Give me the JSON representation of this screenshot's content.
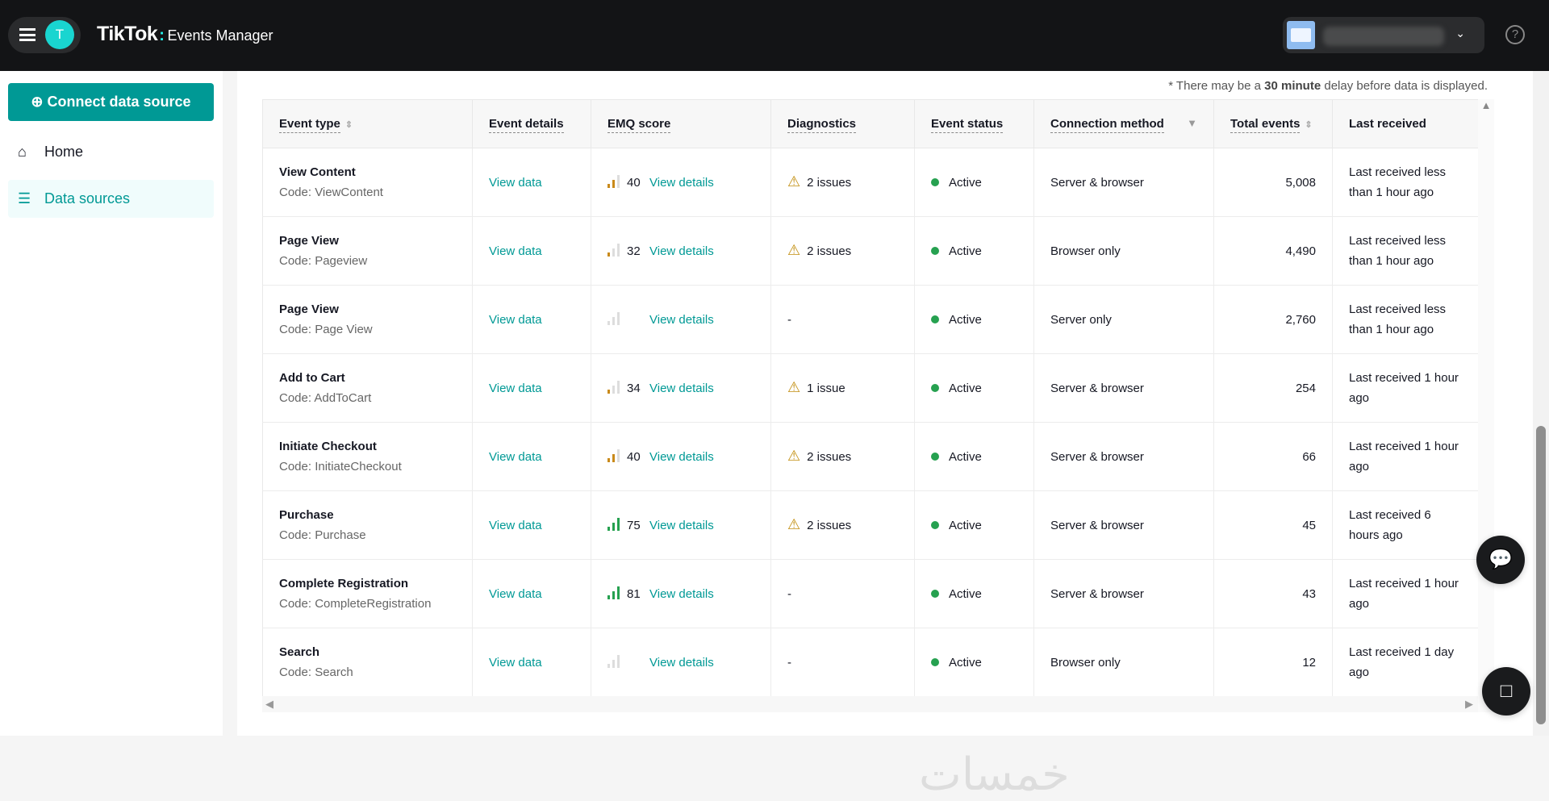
{
  "header": {
    "avatar_letter": "T",
    "logo": "TikTok",
    "app_name": "Events Manager",
    "help": "?"
  },
  "sidebar": {
    "connect_label": "Connect data source",
    "items": [
      {
        "label": "Home"
      },
      {
        "label": "Data sources"
      }
    ]
  },
  "note": {
    "prefix": "* There may be a ",
    "bold": "30 minute",
    "suffix": " delay before data is displayed."
  },
  "table": {
    "columns": [
      "Event type",
      "Event details",
      "EMQ score",
      "Diagnostics",
      "Event status",
      "Connection method",
      "Total events",
      "Last received"
    ],
    "rows": [
      {
        "name": "View Content",
        "code": "Code: ViewContent",
        "details": "View data",
        "emq": "40",
        "emq_level": 2,
        "emq_color": "#c98a1b",
        "emq_link": "View details",
        "diag": "2 issues",
        "warn": true,
        "status": "Active",
        "method": "Server & browser",
        "total": "5,008",
        "last": "Last received less than 1 hour ago"
      },
      {
        "name": "Page View",
        "code": "Code: Pageview",
        "details": "View data",
        "emq": "32",
        "emq_level": 1,
        "emq_color": "#c98a1b",
        "emq_link": "View details",
        "diag": "2 issues",
        "warn": true,
        "status": "Active",
        "method": "Browser only",
        "total": "4,490",
        "last": "Last received less than 1 hour ago"
      },
      {
        "name": "Page View",
        "code": "Code: Page View",
        "details": "View data",
        "emq": "",
        "emq_level": 0,
        "emq_color": "#dddddd",
        "emq_link": "View details",
        "diag": "-",
        "warn": false,
        "status": "Active",
        "method": "Server only",
        "total": "2,760",
        "last": "Last received less than 1 hour ago"
      },
      {
        "name": "Add to Cart",
        "code": "Code: AddToCart",
        "details": "View data",
        "emq": "34",
        "emq_level": 1,
        "emq_color": "#c98a1b",
        "emq_link": "View details",
        "diag": "1 issue",
        "warn": true,
        "status": "Active",
        "method": "Server & browser",
        "total": "254",
        "last": "Last received 1 hour ago"
      },
      {
        "name": "Initiate Checkout",
        "code": "Code: InitiateCheckout",
        "details": "View data",
        "emq": "40",
        "emq_level": 2,
        "emq_color": "#c98a1b",
        "emq_link": "View details",
        "diag": "2 issues",
        "warn": true,
        "status": "Active",
        "method": "Server & browser",
        "total": "66",
        "last": "Last received 1 hour ago"
      },
      {
        "name": "Purchase",
        "code": "Code: Purchase",
        "details": "View data",
        "emq": "75",
        "emq_level": 3,
        "emq_color": "#26a150",
        "emq_link": "View details",
        "diag": "2 issues",
        "warn": true,
        "status": "Active",
        "method": "Server & browser",
        "total": "45",
        "last": "Last received 6 hours ago"
      },
      {
        "name": "Complete Registration",
        "code": "Code: CompleteRegistration",
        "details": "View data",
        "emq": "81",
        "emq_level": 3,
        "emq_color": "#26a150",
        "emq_link": "View details",
        "diag": "-",
        "warn": false,
        "status": "Active",
        "method": "Server & browser",
        "total": "43",
        "last": "Last received 1 hour ago"
      },
      {
        "name": "Search",
        "code": "Code: Search",
        "details": "View data",
        "emq": "",
        "emq_level": 0,
        "emq_color": "#dddddd",
        "emq_link": "View details",
        "diag": "-",
        "warn": false,
        "status": "Active",
        "method": "Browser only",
        "total": "12",
        "last": "Last received 1 day ago"
      }
    ]
  },
  "watermark": "خمسات"
}
